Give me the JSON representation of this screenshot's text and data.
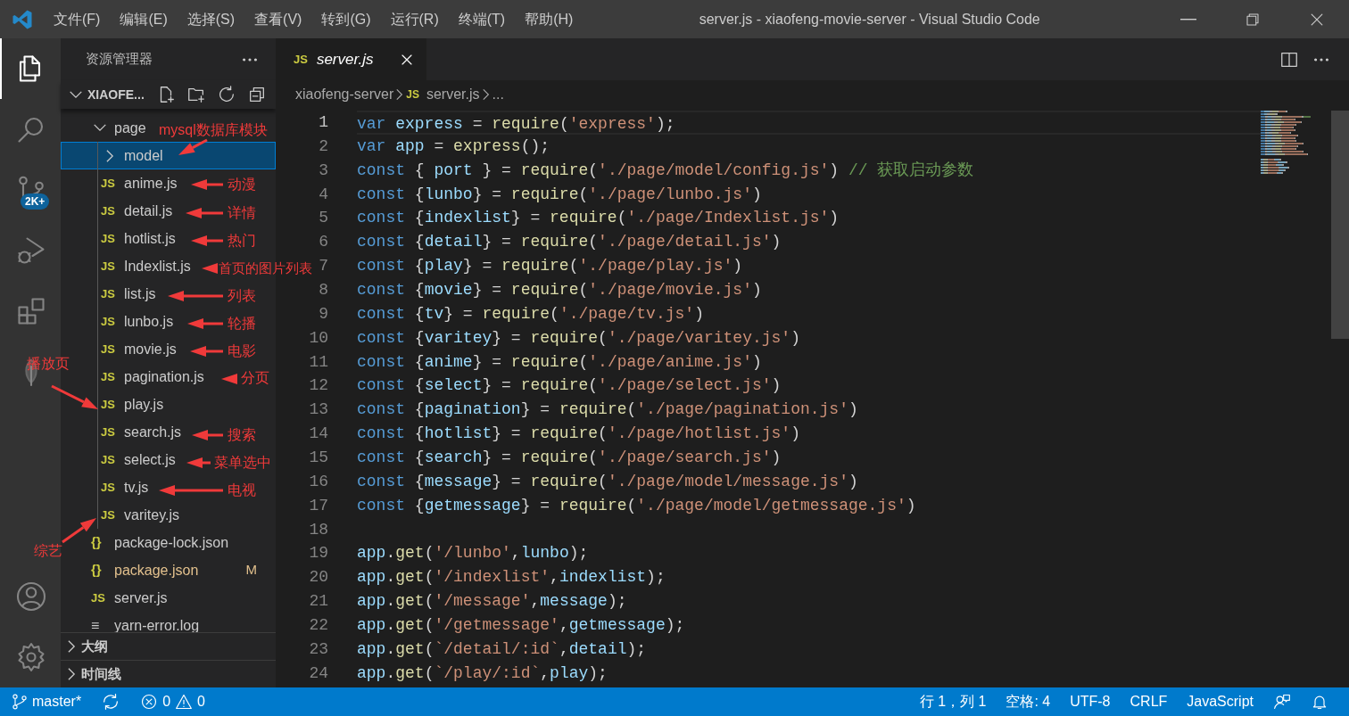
{
  "title_bar": {
    "menus": [
      "文件(F)",
      "编辑(E)",
      "选择(S)",
      "查看(V)",
      "转到(G)",
      "运行(R)",
      "终端(T)",
      "帮助(H)"
    ],
    "title": "server.js - xiaofeng-movie-server - Visual Studio Code"
  },
  "activity_bar": [
    {
      "kind": "files",
      "selected": true
    },
    {
      "kind": "search",
      "selected": false
    },
    {
      "kind": "scm",
      "selected": false,
      "badge": "2K+"
    },
    {
      "kind": "debug",
      "selected": false
    },
    {
      "kind": "extensions",
      "selected": false
    },
    {
      "kind": "leaf",
      "selected": false
    }
  ],
  "activity_bar_bottom": [
    {
      "kind": "account"
    },
    {
      "kind": "settings"
    }
  ],
  "explorer": {
    "title": "资源管理器",
    "root": {
      "label": "XIAOFE...",
      "expanded": true,
      "children": [
        {
          "kind": "folder",
          "label": "page",
          "expanded": true,
          "selected": false,
          "children": [
            {
              "kind": "folder",
              "label": "model",
              "expanded": false,
              "selected": true
            },
            {
              "kind": "js",
              "icon": "JS",
              "label": "anime.js",
              "selected": false
            },
            {
              "kind": "js",
              "icon": "JS",
              "label": "detail.js",
              "selected": false
            },
            {
              "kind": "js",
              "icon": "JS",
              "label": "hotlist.js",
              "selected": false
            },
            {
              "kind": "js",
              "icon": "JS",
              "label": "Indexlist.js",
              "selected": false
            },
            {
              "kind": "js",
              "icon": "JS",
              "label": "list.js",
              "selected": false
            },
            {
              "kind": "js",
              "icon": "JS",
              "label": "lunbo.js",
              "selected": false
            },
            {
              "kind": "js",
              "icon": "JS",
              "label": "movie.js",
              "selected": false
            },
            {
              "kind": "js",
              "icon": "JS",
              "label": "pagination.js",
              "selected": false
            },
            {
              "kind": "js",
              "icon": "JS",
              "label": "play.js",
              "selected": false
            },
            {
              "kind": "js",
              "icon": "JS",
              "label": "search.js",
              "selected": false
            },
            {
              "kind": "js",
              "icon": "JS",
              "label": "select.js",
              "selected": false
            },
            {
              "kind": "js",
              "icon": "JS",
              "label": "tv.js",
              "selected": false
            },
            {
              "kind": "js",
              "icon": "JS",
              "label": "varitey.js",
              "selected": false
            }
          ]
        },
        {
          "kind": "json",
          "icon": "{}",
          "label": "package-lock.json",
          "selected": false,
          "modified": false
        },
        {
          "kind": "json",
          "icon": "{}",
          "label": "package.json",
          "selected": false,
          "modified": true,
          "status": "M"
        },
        {
          "kind": "js",
          "icon": "JS",
          "label": "server.js",
          "selected": false
        },
        {
          "kind": "log",
          "icon": "≡",
          "label": "yarn-error.log",
          "selected": false
        }
      ]
    },
    "panels": [
      {
        "label": "大纲",
        "expanded": false
      },
      {
        "label": "时间线",
        "expanded": false
      }
    ]
  },
  "editor": {
    "tabs": [
      {
        "icon": "JS",
        "label": "server.js",
        "selected": true,
        "preview": true
      }
    ],
    "breadcrumb": [
      {
        "label": "xiaofeng-server"
      },
      {
        "icon": "JS",
        "label": "server.js"
      },
      {
        "label": "..."
      }
    ],
    "lines": [
      {
        "number": "1",
        "current": true,
        "tokens": [
          {
            "kind": "kw",
            "text": "var "
          },
          {
            "kind": "var",
            "text": "express"
          },
          {
            "kind": "p",
            "text": " = "
          },
          {
            "kind": "fn",
            "text": "require"
          },
          {
            "kind": "p",
            "text": "("
          },
          {
            "kind": "str",
            "text": "'express'"
          },
          {
            "kind": "p",
            "text": ");"
          }
        ]
      },
      {
        "number": "2",
        "current": false,
        "tokens": [
          {
            "kind": "kw",
            "text": "var "
          },
          {
            "kind": "var",
            "text": "app"
          },
          {
            "kind": "p",
            "text": " = "
          },
          {
            "kind": "fn",
            "text": "express"
          },
          {
            "kind": "p",
            "text": "();"
          }
        ]
      },
      {
        "number": "3",
        "current": false,
        "tokens": [
          {
            "kind": "kw",
            "text": "const"
          },
          {
            "kind": "p",
            "text": " { "
          },
          {
            "kind": "var",
            "text": "port"
          },
          {
            "kind": "p",
            "text": " } = "
          },
          {
            "kind": "fn",
            "text": "require"
          },
          {
            "kind": "p",
            "text": "("
          },
          {
            "kind": "str",
            "text": "'./page/model/config.js'"
          },
          {
            "kind": "p",
            "text": ") "
          },
          {
            "kind": "cm",
            "text": "// 获取启动参数"
          }
        ]
      },
      {
        "number": "4",
        "current": false,
        "tokens": [
          {
            "kind": "kw",
            "text": "const"
          },
          {
            "kind": "p",
            "text": " {"
          },
          {
            "kind": "var",
            "text": "lunbo"
          },
          {
            "kind": "p",
            "text": "} = "
          },
          {
            "kind": "fn",
            "text": "require"
          },
          {
            "kind": "p",
            "text": "("
          },
          {
            "kind": "str",
            "text": "'./page/lunbo.js'"
          },
          {
            "kind": "p",
            "text": ")"
          }
        ]
      },
      {
        "number": "5",
        "current": false,
        "tokens": [
          {
            "kind": "kw",
            "text": "const"
          },
          {
            "kind": "p",
            "text": " {"
          },
          {
            "kind": "var",
            "text": "indexlist"
          },
          {
            "kind": "p",
            "text": "} = "
          },
          {
            "kind": "fn",
            "text": "require"
          },
          {
            "kind": "p",
            "text": "("
          },
          {
            "kind": "str",
            "text": "'./page/Indexlist.js'"
          },
          {
            "kind": "p",
            "text": ")"
          }
        ]
      },
      {
        "number": "6",
        "current": false,
        "tokens": [
          {
            "kind": "kw",
            "text": "const"
          },
          {
            "kind": "p",
            "text": " {"
          },
          {
            "kind": "var",
            "text": "detail"
          },
          {
            "kind": "p",
            "text": "} = "
          },
          {
            "kind": "fn",
            "text": "require"
          },
          {
            "kind": "p",
            "text": "("
          },
          {
            "kind": "str",
            "text": "'./page/detail.js'"
          },
          {
            "kind": "p",
            "text": ")"
          }
        ]
      },
      {
        "number": "7",
        "current": false,
        "tokens": [
          {
            "kind": "kw",
            "text": "const"
          },
          {
            "kind": "p",
            "text": " {"
          },
          {
            "kind": "var",
            "text": "play"
          },
          {
            "kind": "p",
            "text": "} = "
          },
          {
            "kind": "fn",
            "text": "require"
          },
          {
            "kind": "p",
            "text": "("
          },
          {
            "kind": "str",
            "text": "'./page/play.js'"
          },
          {
            "kind": "p",
            "text": ")"
          }
        ]
      },
      {
        "number": "8",
        "current": false,
        "tokens": [
          {
            "kind": "kw",
            "text": "const"
          },
          {
            "kind": "p",
            "text": " {"
          },
          {
            "kind": "var",
            "text": "movie"
          },
          {
            "kind": "p",
            "text": "} = "
          },
          {
            "kind": "fn",
            "text": "require"
          },
          {
            "kind": "p",
            "text": "("
          },
          {
            "kind": "str",
            "text": "'./page/movie.js'"
          },
          {
            "kind": "p",
            "text": ")"
          }
        ]
      },
      {
        "number": "9",
        "current": false,
        "tokens": [
          {
            "kind": "kw",
            "text": "const"
          },
          {
            "kind": "p",
            "text": " {"
          },
          {
            "kind": "var",
            "text": "tv"
          },
          {
            "kind": "p",
            "text": "} = "
          },
          {
            "kind": "fn",
            "text": "require"
          },
          {
            "kind": "p",
            "text": "("
          },
          {
            "kind": "str",
            "text": "'./page/tv.js'"
          },
          {
            "kind": "p",
            "text": ")"
          }
        ]
      },
      {
        "number": "10",
        "current": false,
        "tokens": [
          {
            "kind": "kw",
            "text": "const"
          },
          {
            "kind": "p",
            "text": " {"
          },
          {
            "kind": "var",
            "text": "varitey"
          },
          {
            "kind": "p",
            "text": "} = "
          },
          {
            "kind": "fn",
            "text": "require"
          },
          {
            "kind": "p",
            "text": "("
          },
          {
            "kind": "str",
            "text": "'./page/varitey.js'"
          },
          {
            "kind": "p",
            "text": ")"
          }
        ]
      },
      {
        "number": "11",
        "current": false,
        "tokens": [
          {
            "kind": "kw",
            "text": "const"
          },
          {
            "kind": "p",
            "text": " {"
          },
          {
            "kind": "var",
            "text": "anime"
          },
          {
            "kind": "p",
            "text": "} = "
          },
          {
            "kind": "fn",
            "text": "require"
          },
          {
            "kind": "p",
            "text": "("
          },
          {
            "kind": "str",
            "text": "'./page/anime.js'"
          },
          {
            "kind": "p",
            "text": ")"
          }
        ]
      },
      {
        "number": "12",
        "current": false,
        "tokens": [
          {
            "kind": "kw",
            "text": "const"
          },
          {
            "kind": "p",
            "text": " {"
          },
          {
            "kind": "var",
            "text": "select"
          },
          {
            "kind": "p",
            "text": "} = "
          },
          {
            "kind": "fn",
            "text": "require"
          },
          {
            "kind": "p",
            "text": "("
          },
          {
            "kind": "str",
            "text": "'./page/select.js'"
          },
          {
            "kind": "p",
            "text": ")"
          }
        ]
      },
      {
        "number": "13",
        "current": false,
        "tokens": [
          {
            "kind": "kw",
            "text": "const"
          },
          {
            "kind": "p",
            "text": " {"
          },
          {
            "kind": "var",
            "text": "pagination"
          },
          {
            "kind": "p",
            "text": "} = "
          },
          {
            "kind": "fn",
            "text": "require"
          },
          {
            "kind": "p",
            "text": "("
          },
          {
            "kind": "str",
            "text": "'./page/pagination.js'"
          },
          {
            "kind": "p",
            "text": ")"
          }
        ]
      },
      {
        "number": "14",
        "current": false,
        "tokens": [
          {
            "kind": "kw",
            "text": "const"
          },
          {
            "kind": "p",
            "text": " {"
          },
          {
            "kind": "var",
            "text": "hotlist"
          },
          {
            "kind": "p",
            "text": "} = "
          },
          {
            "kind": "fn",
            "text": "require"
          },
          {
            "kind": "p",
            "text": "("
          },
          {
            "kind": "str",
            "text": "'./page/hotlist.js'"
          },
          {
            "kind": "p",
            "text": ")"
          }
        ]
      },
      {
        "number": "15",
        "current": false,
        "tokens": [
          {
            "kind": "kw",
            "text": "const"
          },
          {
            "kind": "p",
            "text": " {"
          },
          {
            "kind": "var",
            "text": "search"
          },
          {
            "kind": "p",
            "text": "} = "
          },
          {
            "kind": "fn",
            "text": "require"
          },
          {
            "kind": "p",
            "text": "("
          },
          {
            "kind": "str",
            "text": "'./page/search.js'"
          },
          {
            "kind": "p",
            "text": ")"
          }
        ]
      },
      {
        "number": "16",
        "current": false,
        "tokens": [
          {
            "kind": "kw",
            "text": "const"
          },
          {
            "kind": "p",
            "text": " {"
          },
          {
            "kind": "var",
            "text": "message"
          },
          {
            "kind": "p",
            "text": "} = "
          },
          {
            "kind": "fn",
            "text": "require"
          },
          {
            "kind": "p",
            "text": "("
          },
          {
            "kind": "str",
            "text": "'./page/model/message.js'"
          },
          {
            "kind": "p",
            "text": ")"
          }
        ]
      },
      {
        "number": "17",
        "current": false,
        "tokens": [
          {
            "kind": "kw",
            "text": "const"
          },
          {
            "kind": "p",
            "text": " {"
          },
          {
            "kind": "var",
            "text": "getmessage"
          },
          {
            "kind": "p",
            "text": "} = "
          },
          {
            "kind": "fn",
            "text": "require"
          },
          {
            "kind": "p",
            "text": "("
          },
          {
            "kind": "str",
            "text": "'./page/model/getmessage.js'"
          },
          {
            "kind": "p",
            "text": ")"
          }
        ]
      },
      {
        "number": "18",
        "current": false
      },
      {
        "number": "19",
        "current": false,
        "tokens": [
          {
            "kind": "var",
            "text": "app"
          },
          {
            "kind": "p",
            "text": "."
          },
          {
            "kind": "fn",
            "text": "get"
          },
          {
            "kind": "p",
            "text": "("
          },
          {
            "kind": "str",
            "text": "'/lunbo'"
          },
          {
            "kind": "p",
            "text": ","
          },
          {
            "kind": "var",
            "text": "lunbo"
          },
          {
            "kind": "p",
            "text": ");"
          }
        ]
      },
      {
        "number": "20",
        "current": false,
        "tokens": [
          {
            "kind": "var",
            "text": "app"
          },
          {
            "kind": "p",
            "text": "."
          },
          {
            "kind": "fn",
            "text": "get"
          },
          {
            "kind": "p",
            "text": "("
          },
          {
            "kind": "str",
            "text": "'/indexlist'"
          },
          {
            "kind": "p",
            "text": ","
          },
          {
            "kind": "var",
            "text": "indexlist"
          },
          {
            "kind": "p",
            "text": ");"
          }
        ]
      },
      {
        "number": "21",
        "current": false,
        "tokens": [
          {
            "kind": "var",
            "text": "app"
          },
          {
            "kind": "p",
            "text": "."
          },
          {
            "kind": "fn",
            "text": "get"
          },
          {
            "kind": "p",
            "text": "("
          },
          {
            "kind": "str",
            "text": "'/message'"
          },
          {
            "kind": "p",
            "text": ","
          },
          {
            "kind": "var",
            "text": "message"
          },
          {
            "kind": "p",
            "text": ");"
          }
        ]
      },
      {
        "number": "22",
        "current": false,
        "tokens": [
          {
            "kind": "var",
            "text": "app"
          },
          {
            "kind": "p",
            "text": "."
          },
          {
            "kind": "fn",
            "text": "get"
          },
          {
            "kind": "p",
            "text": "("
          },
          {
            "kind": "str",
            "text": "'/getmessage'"
          },
          {
            "kind": "p",
            "text": ","
          },
          {
            "kind": "var",
            "text": "getmessage"
          },
          {
            "kind": "p",
            "text": ");"
          }
        ]
      },
      {
        "number": "23",
        "current": false,
        "tokens": [
          {
            "kind": "var",
            "text": "app"
          },
          {
            "kind": "p",
            "text": "."
          },
          {
            "kind": "fn",
            "text": "get"
          },
          {
            "kind": "p",
            "text": "("
          },
          {
            "kind": "str",
            "text": "`/detail/:id`"
          },
          {
            "kind": "p",
            "text": ","
          },
          {
            "kind": "var",
            "text": "detail"
          },
          {
            "kind": "p",
            "text": ");"
          }
        ]
      },
      {
        "number": "24",
        "current": false,
        "tokens": [
          {
            "kind": "var",
            "text": "app"
          },
          {
            "kind": "p",
            "text": "."
          },
          {
            "kind": "fn",
            "text": "get"
          },
          {
            "kind": "p",
            "text": "("
          },
          {
            "kind": "str",
            "text": "`/play/:id`"
          },
          {
            "kind": "p",
            "text": ","
          },
          {
            "kind": "var",
            "text": "play"
          },
          {
            "kind": "p",
            "text": ");"
          }
        ]
      }
    ]
  },
  "status_bar": {
    "branch": "master*",
    "errors": "0",
    "warnings": "0",
    "right": [
      "行 1，列 1",
      "空格: 4",
      "UTF-8",
      "CRLF",
      "JavaScript"
    ]
  },
  "annotations": [
    "mysql数据库模块",
    "动漫",
    "详情",
    "热门",
    "首页的图片列表",
    "列表",
    "轮播",
    "电影",
    "播放页",
    "分页",
    "搜索",
    "菜单选中",
    "电视",
    "综艺"
  ]
}
